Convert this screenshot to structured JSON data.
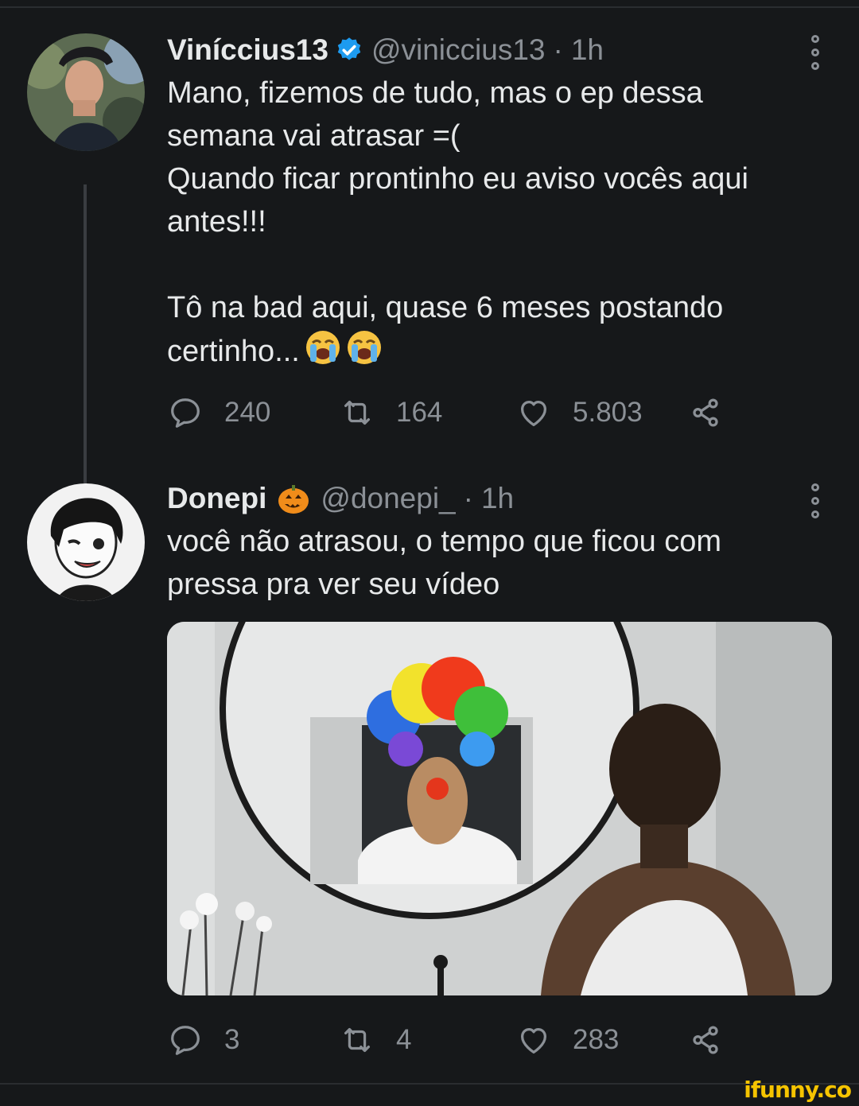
{
  "tweets": [
    {
      "name": "Viníccius13",
      "handle": "@viniccius13",
      "time": "1h",
      "text": "Mano, fizemos de tudo, mas o ep dessa\nsemana vai atrasar =(\nQuando ficar prontinho eu aviso vocês aqui\nantes!!!\n\nTô na bad aqui, quase 6 meses postando\ncertinho...",
      "emoji": [
        "loudly-crying-face",
        "loudly-crying-face"
      ],
      "replies": "240",
      "retweets": "164",
      "likes": "5.803"
    },
    {
      "name": "Donepi",
      "handle": "@donepi_",
      "time": "1h",
      "text": "você não atrasou, o tempo que ficou com\npressa pra ver seu vídeo",
      "replies": "3",
      "retweets": "4",
      "likes": "283"
    }
  ],
  "separator": "·",
  "icons": {
    "verified": "verified-badge-icon",
    "name_emoji": "jack-o-lantern-icon",
    "reply": "comment-icon",
    "retweet": "retweet-icon",
    "like": "heart-icon",
    "share": "share-icon",
    "more": "more-vertical-icon"
  },
  "colors": {
    "background": "#16181a",
    "text": "#e7e9ea",
    "muted": "#8b9096",
    "verified": "#1d9bf0",
    "watermark": "#f6c400"
  },
  "watermark": "ifunny.co"
}
